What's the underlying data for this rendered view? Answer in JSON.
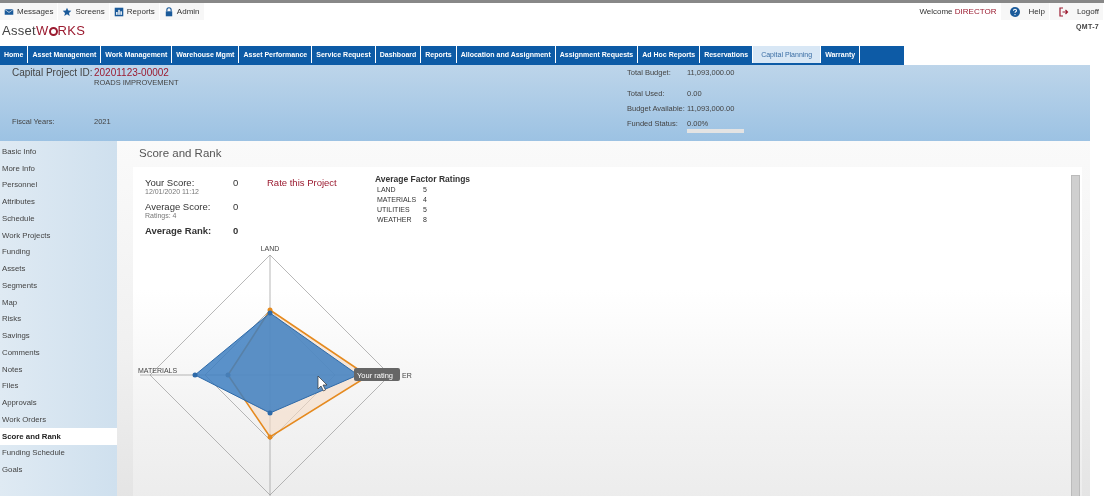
{
  "top_links": [
    {
      "label": "Messages"
    },
    {
      "label": "Screens"
    },
    {
      "label": "Reports"
    },
    {
      "label": "Admin"
    }
  ],
  "user": {
    "welcome": "Welcome",
    "name": "DIRECTOR",
    "help": "Help",
    "logoff": "Logoff",
    "code": "QMT-7"
  },
  "logo": {
    "part1": "Asset",
    "part2": "W",
    "part3": "RKS"
  },
  "nav_tabs": [
    {
      "label": "Home",
      "selected": false
    },
    {
      "label": "Asset Management",
      "selected": false
    },
    {
      "label": "Work Management",
      "selected": false
    },
    {
      "label": "Warehouse Mgmt",
      "selected": false
    },
    {
      "label": "Asset Performance",
      "selected": false
    },
    {
      "label": "Service Request",
      "selected": false
    },
    {
      "label": "Dashboard",
      "selected": false
    },
    {
      "label": "Reports",
      "selected": false
    },
    {
      "label": "Allocation and Assignment",
      "selected": false
    },
    {
      "label": "Assignment Requests",
      "selected": false
    },
    {
      "label": "Ad Hoc Reports",
      "selected": false
    },
    {
      "label": "Reservations",
      "selected": false
    },
    {
      "label": "Capital Planning",
      "selected": true
    },
    {
      "label": "Warranty",
      "selected": false
    }
  ],
  "project": {
    "id_label": "Capital Project ID:",
    "id": "20201123-00002",
    "name": "ROADS IMPROVEMENT",
    "fiscal_label": "Fiscal Years:",
    "fiscal": "2021",
    "budget": [
      {
        "label": "Total Budget:",
        "value": "11,093,000.00"
      },
      {
        "label": "Total Used:",
        "value": "0.00"
      },
      {
        "label": "Budget Available:",
        "value": "11,093,000.00"
      },
      {
        "label": "Funded Status:",
        "value": "0.00%",
        "level": 0
      }
    ]
  },
  "sidebar": {
    "items": [
      {
        "label": "Basic Info",
        "selected": false
      },
      {
        "label": "More Info",
        "selected": false
      },
      {
        "label": "Personnel",
        "selected": false
      },
      {
        "label": "Attributes",
        "selected": false
      },
      {
        "label": "Schedule",
        "selected": false
      },
      {
        "label": "Work Projects",
        "selected": false
      },
      {
        "label": "Funding",
        "selected": false
      },
      {
        "label": "Assets",
        "selected": false
      },
      {
        "label": "Segments",
        "selected": false
      },
      {
        "label": "Map",
        "selected": false
      },
      {
        "label": "Risks",
        "selected": false
      },
      {
        "label": "Savings",
        "selected": false
      },
      {
        "label": "Comments",
        "selected": false
      },
      {
        "label": "Notes",
        "selected": false
      },
      {
        "label": "Files",
        "selected": false
      },
      {
        "label": "Approvals",
        "selected": false
      },
      {
        "label": "Work Orders",
        "selected": false
      },
      {
        "label": "Score and Rank",
        "selected": true
      },
      {
        "label": "Funding Schedule",
        "selected": false
      },
      {
        "label": "Goals",
        "selected": false
      }
    ]
  },
  "score": {
    "title": "Score and Rank",
    "your_score_label": "Your Score:",
    "your_score": "0",
    "your_score_date": "12/01/2020 11:12",
    "rate_link": "Rate this Project",
    "average_score_label": "Average Score:",
    "average_score": "0",
    "ratings": "Ratings: 4",
    "average_rank_label": "Average Rank:",
    "average_rank": "0",
    "factors_title": "Average Factor Ratings",
    "factors": [
      {
        "name": "LAND",
        "value": "5"
      },
      {
        "name": "MATERIALS",
        "value": "4"
      },
      {
        "name": "UTILITIES",
        "value": "5"
      },
      {
        "name": "WEATHER",
        "value": "8"
      }
    ],
    "radar": {
      "top_label": "LAND",
      "left_label": "MATERIALS",
      "right_label": "ER",
      "tooltip": "Your rating"
    }
  }
}
